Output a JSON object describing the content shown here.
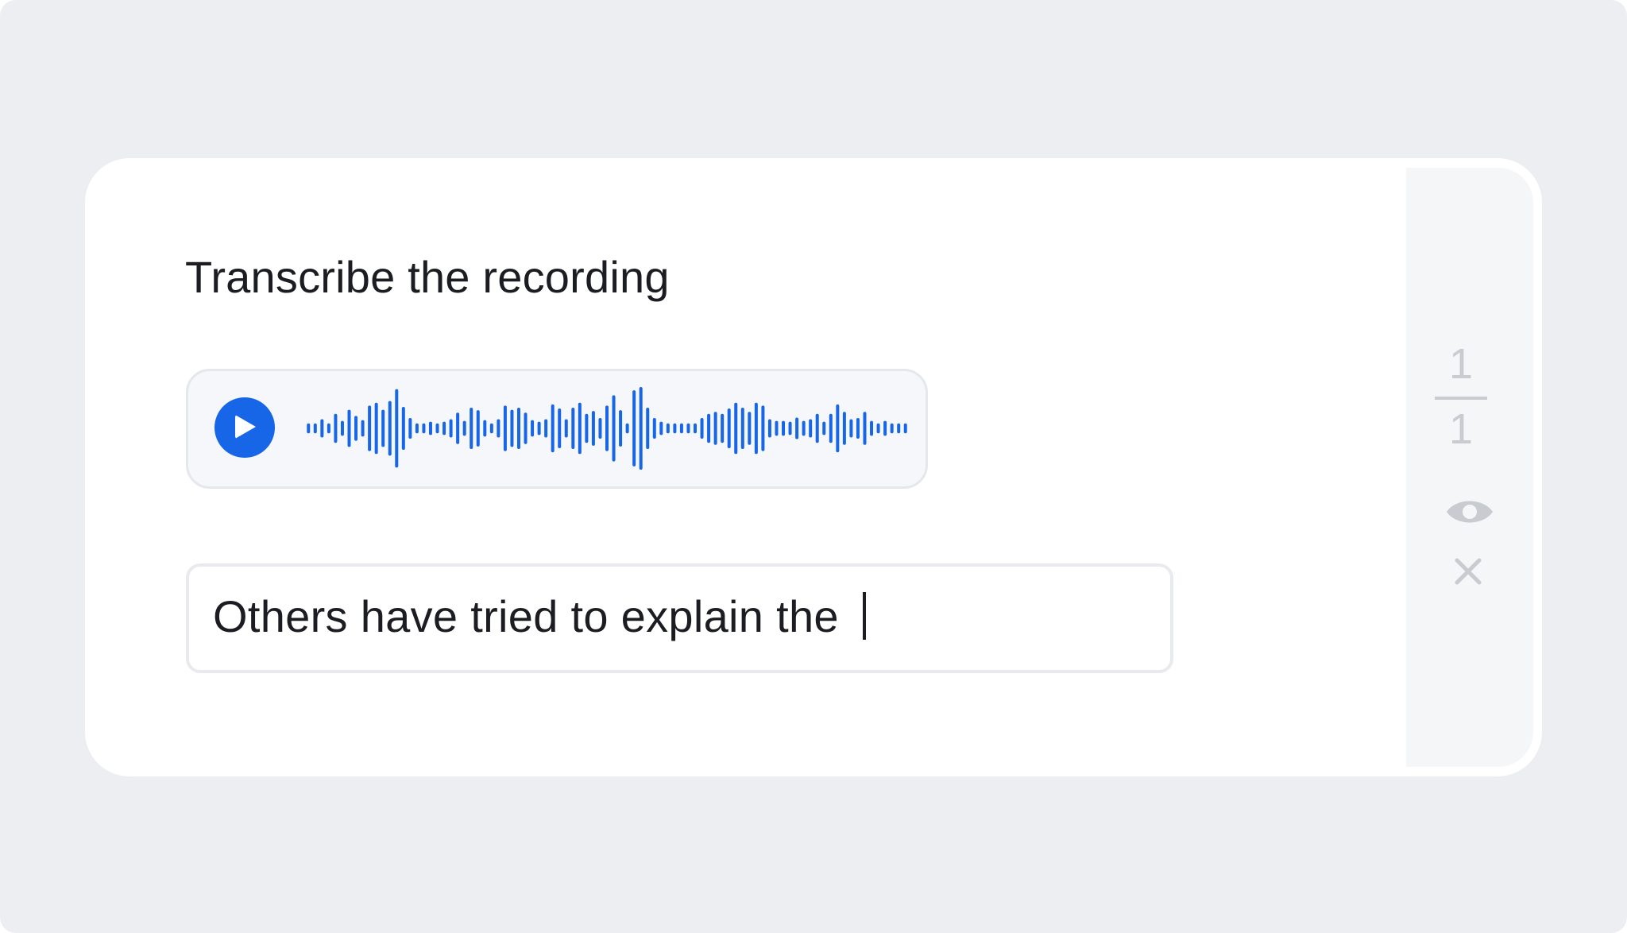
{
  "task": {
    "prompt": "Transcribe the recording"
  },
  "audio": {
    "play_icon": "play-icon",
    "accent_color": "#1766e8",
    "waveform_levels": [
      0.12,
      0.12,
      0.22,
      0.12,
      0.35,
      0.18,
      0.45,
      0.3,
      0.2,
      0.55,
      0.62,
      0.45,
      0.66,
      0.95,
      0.52,
      0.25,
      0.12,
      0.12,
      0.16,
      0.12,
      0.16,
      0.22,
      0.38,
      0.18,
      0.5,
      0.44,
      0.2,
      0.12,
      0.22,
      0.55,
      0.45,
      0.5,
      0.38,
      0.2,
      0.16,
      0.22,
      0.58,
      0.48,
      0.22,
      0.5,
      0.62,
      0.35,
      0.42,
      0.25,
      0.55,
      0.8,
      0.44,
      0.12,
      0.92,
      1.0,
      0.5,
      0.25,
      0.16,
      0.12,
      0.12,
      0.12,
      0.12,
      0.12,
      0.25,
      0.35,
      0.4,
      0.35,
      0.48,
      0.62,
      0.5,
      0.4,
      0.62,
      0.55,
      0.22,
      0.18,
      0.18,
      0.16,
      0.26,
      0.18,
      0.22,
      0.35,
      0.16,
      0.35,
      0.58,
      0.4,
      0.22,
      0.25,
      0.4,
      0.18,
      0.12,
      0.18,
      0.12,
      0.12,
      0.12
    ]
  },
  "answer": {
    "value": "Others have tried to explain the "
  },
  "pager": {
    "current": "1",
    "total": "1"
  },
  "side_actions": {
    "show_icon": "eye-icon",
    "close_icon": "close-icon"
  }
}
